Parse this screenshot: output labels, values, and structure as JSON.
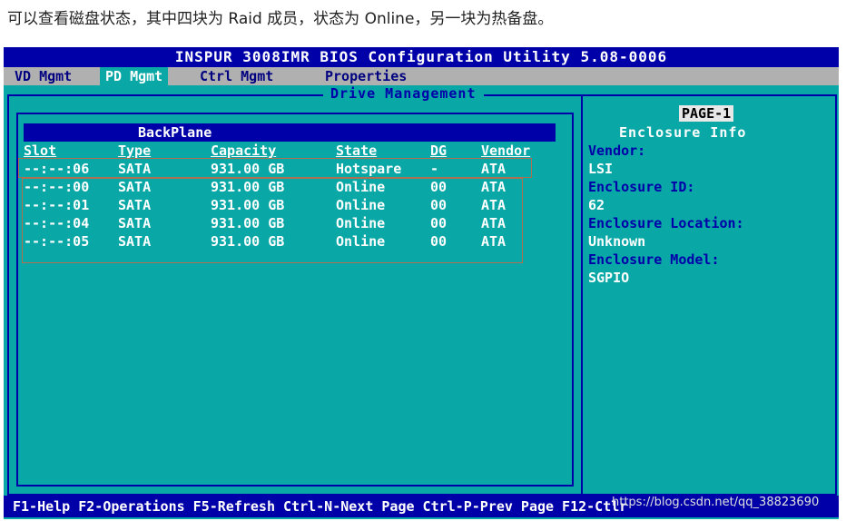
{
  "caption": "可以查看磁盘状态，其中四块为 Raid 成员，状态为 Online，另一块为热备盘。",
  "title": "INSPUR 3008IMR BIOS Configuration Utility 5.08-0006",
  "menu": [
    "VD Mgmt",
    "PD Mgmt",
    "Ctrl Mgmt",
    "Properties"
  ],
  "active_menu": "PD Mgmt",
  "panel_title": "Drive Management",
  "backplane": {
    "header": "BackPlane",
    "columns": [
      "Slot",
      "Type",
      "Capacity",
      "State",
      "DG",
      "Vendor"
    ],
    "rows": [
      {
        "slot": "--:--:06",
        "type": "SATA",
        "capacity": "931.00 GB",
        "state": "Hotspare",
        "dg": "-",
        "vendor": "ATA"
      },
      {
        "slot": "--:--:00",
        "type": "SATA",
        "capacity": "931.00 GB",
        "state": "Online",
        "dg": "00",
        "vendor": "ATA"
      },
      {
        "slot": "--:--:01",
        "type": "SATA",
        "capacity": "931.00 GB",
        "state": "Online",
        "dg": "00",
        "vendor": "ATA"
      },
      {
        "slot": "--:--:04",
        "type": "SATA",
        "capacity": "931.00 GB",
        "state": "Online",
        "dg": "00",
        "vendor": "ATA"
      },
      {
        "slot": "--:--:05",
        "type": "SATA",
        "capacity": "931.00 GB",
        "state": "Online",
        "dg": "00",
        "vendor": "ATA"
      }
    ]
  },
  "info": {
    "page": "PAGE-1",
    "heading": "Enclosure Info",
    "vendor_label": "Vendor:",
    "vendor": "LSI",
    "id_label": "Enclosure ID:",
    "id": "62",
    "location_label": "Enclosure Location:",
    "location": "Unknown",
    "model_label": "Enclosure Model:",
    "model": "SGPIO"
  },
  "statusbar": "F1-Help F2-Operations F5-Refresh Ctrl-N-Next Page Ctrl-P-Prev Page F12-Ctlr",
  "watermark": "https://blog.csdn.net/qq_38823690",
  "colors": {
    "background": "#0aa7a7",
    "title_bar": "#0000a8",
    "menu_bar": "#b0b0b0",
    "highlight_box": "#b07050"
  }
}
